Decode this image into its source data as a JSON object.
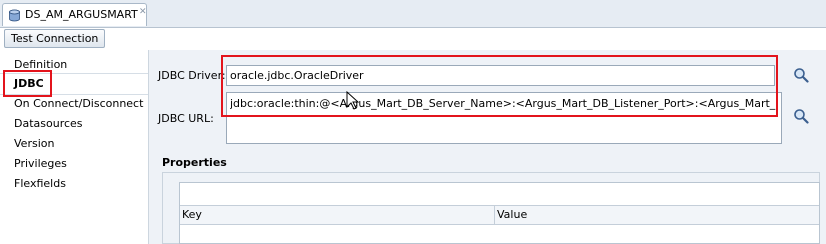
{
  "tab": {
    "title": "DS_AM_ARGUSMART",
    "close_glyph": "✕",
    "icon": "database-icon"
  },
  "toolbar": {
    "test_connection": "Test Connection"
  },
  "nav": {
    "items": [
      {
        "label": "Definition"
      },
      {
        "label": "JDBC",
        "selected": true
      },
      {
        "label": "On Connect/Disconnect"
      },
      {
        "label": "Datasources"
      },
      {
        "label": "Version"
      },
      {
        "label": "Privileges"
      },
      {
        "label": "Flexfields"
      }
    ]
  },
  "jdbc": {
    "driver_label": "JDBC Driver:",
    "driver_value": "oracle.jdbc.OracleDriver",
    "url_label": "JDBC URL:",
    "url_value": "jdbc:oracle:thin:@<Argus_Mart_DB_Server_Name>:<Argus_Mart_DB_Listener_Port>:<Argus_Mart_DB_SID>"
  },
  "properties": {
    "title": "Properties",
    "columns": [
      "Key",
      "Value"
    ],
    "add_icon": "add-icon",
    "delete_icon": "delete-icon"
  },
  "colors": {
    "highlight": "#e3141c",
    "add_green": "#2e9a2e",
    "panel_bg": "#eef2f7"
  }
}
